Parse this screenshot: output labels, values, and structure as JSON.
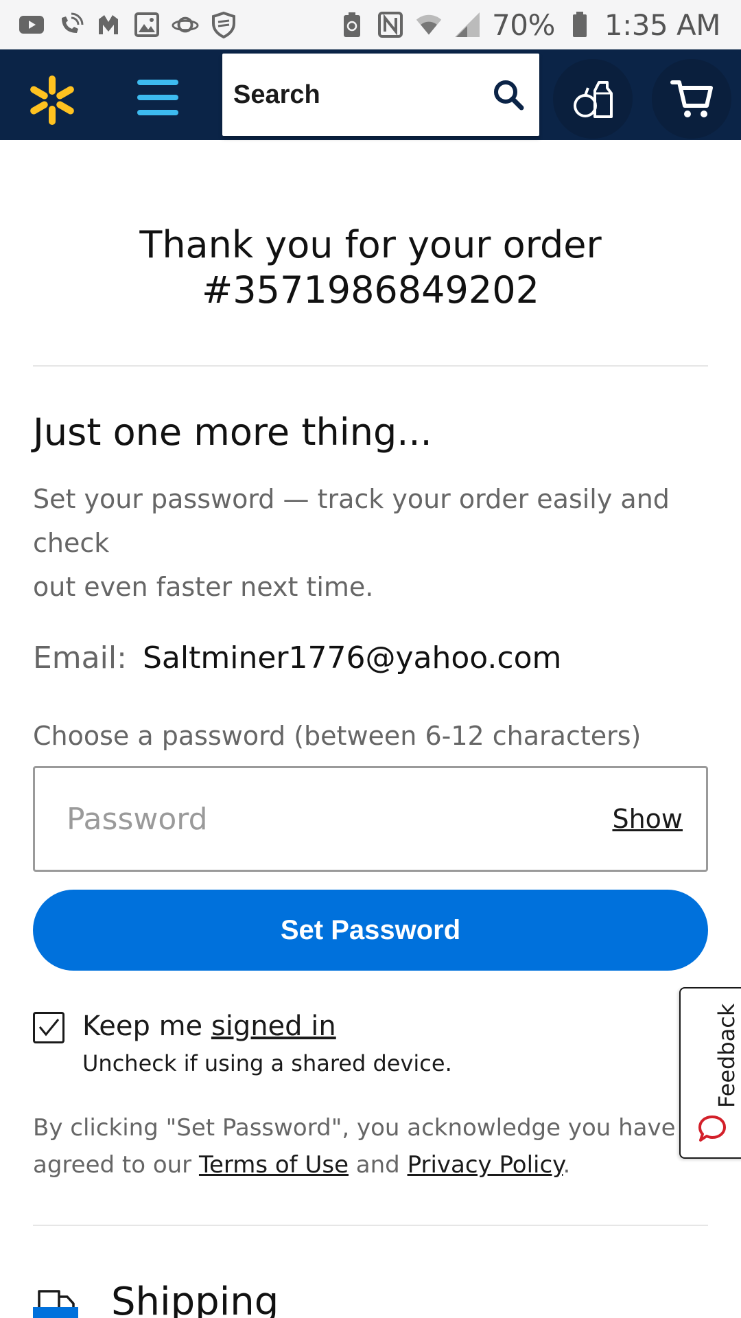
{
  "status_bar": {
    "battery_percent": "70%",
    "time": "1:35 AM",
    "left_icons": [
      "youtube-icon",
      "wifi-calling-icon",
      "malwarebytes-icon",
      "gallery-icon",
      "saturn-icon",
      "shield-icon"
    ],
    "right_icons": [
      "battery-saver-icon",
      "nfc-icon",
      "wifi-icon",
      "signal-icon",
      "battery-icon"
    ]
  },
  "header": {
    "search_label": "Search",
    "icons": [
      "walmart-spark-icon",
      "menu-icon",
      "search-icon",
      "reorder-icon",
      "cart-icon"
    ],
    "brand_color": "#0b2447",
    "accent_color": "#ffc220"
  },
  "confirmation": {
    "title_line1": "Thank you for your order",
    "title_line2": "#3571986849202"
  },
  "account": {
    "heading": "Just one more thing...",
    "description_line1": "Set your password — track your order easily and check",
    "description_line2": "out even faster next time.",
    "email_label": "Email:",
    "email_value": "Saltminer1776@yahoo.com",
    "password_label": "Choose a password (between 6-12 characters)",
    "password_placeholder": "Password",
    "show_label": "Show",
    "set_password_label": "Set Password",
    "button_color": "#0071dc",
    "keep_signed_in_prefix": "Keep me ",
    "keep_signed_in_link": "signed in",
    "keep_signed_in_checked": true,
    "keep_signed_in_note": "Uncheck if using a shared device.",
    "legal_line1": "By clicking \"Set Password\", you acknowledge you have read ar",
    "legal_line2_prefix": "agreed to our ",
    "terms_link": "Terms of Use",
    "legal_and": " and ",
    "privacy_link": "Privacy Policy",
    "legal_period": "."
  },
  "shipping": {
    "title": "Shipping"
  },
  "feedback": {
    "label": "Feedback"
  }
}
